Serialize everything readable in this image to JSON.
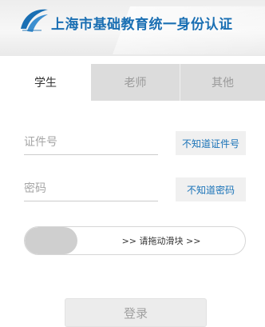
{
  "header": {
    "title": "上海市基础教育统一身份认证",
    "logo_icon": "swoosh-logo-icon",
    "brand_color": "#1a6fb3"
  },
  "tabs": [
    {
      "label": "学生",
      "active": true
    },
    {
      "label": "老师",
      "active": false
    },
    {
      "label": "其他",
      "active": false
    }
  ],
  "form": {
    "id_placeholder": "证件号",
    "id_value": "",
    "id_help": "不知道证件号",
    "password_placeholder": "密码",
    "password_value": "",
    "password_help": "不知道密码",
    "slider_text": ">> 请拖动滑块 >>",
    "login_label": "登录"
  }
}
